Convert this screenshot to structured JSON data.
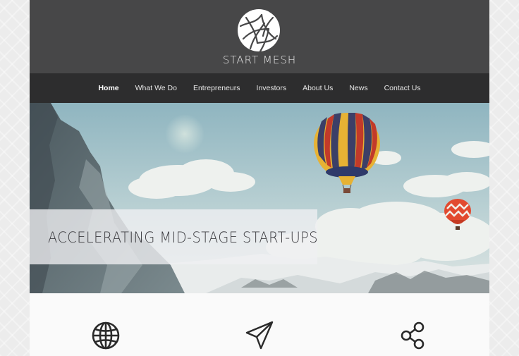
{
  "brand": {
    "name": "START MESH"
  },
  "nav": {
    "items": [
      {
        "label": "Home"
      },
      {
        "label": "What We Do"
      },
      {
        "label": "Entrepreneurs"
      },
      {
        "label": "Investors"
      },
      {
        "label": "About Us"
      },
      {
        "label": "News"
      },
      {
        "label": "Contact Us"
      }
    ],
    "active": "Home"
  },
  "hero": {
    "headline": "ACCELERATING MID-STAGE START-UPS"
  },
  "features": {
    "icons": [
      "globe-icon",
      "paper-plane-icon",
      "share-icon"
    ]
  },
  "colors": {
    "header": "#474748",
    "nav": "#2d2d2e",
    "caption": "#f0f0f2"
  }
}
